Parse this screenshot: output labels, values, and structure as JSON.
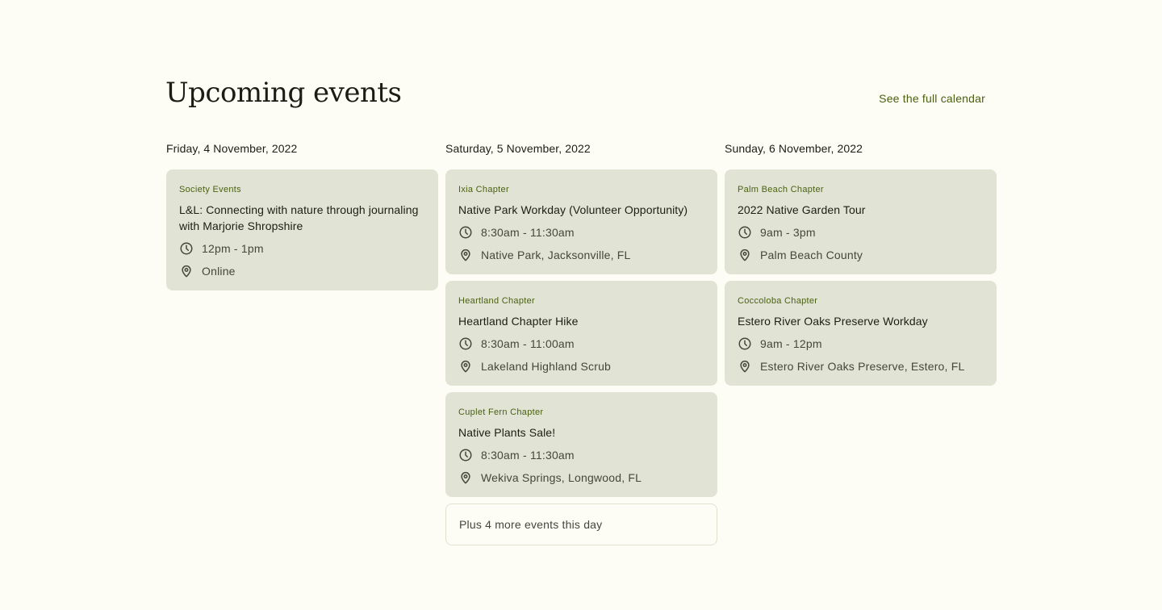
{
  "header": {
    "title": "Upcoming events",
    "calendar_link": "See the full calendar"
  },
  "days": [
    {
      "date": "Friday, 4 November, 2022",
      "events": [
        {
          "chapter": "Society Events",
          "title": "L&L: Connecting with nature through journaling with Marjorie Shropshire",
          "time": "12pm - 1pm",
          "location": "Online"
        }
      ]
    },
    {
      "date": "Saturday, 5 November, 2022",
      "events": [
        {
          "chapter": "Ixia Chapter",
          "title": "Native Park Workday (Volunteer Opportunity)",
          "time": "8:30am - 11:30am",
          "location": "Native Park, Jacksonville, FL"
        },
        {
          "chapter": "Heartland Chapter",
          "title": "Heartland Chapter Hike",
          "time": "8:30am - 11:00am",
          "location": "Lakeland Highland Scrub"
        },
        {
          "chapter": "Cuplet Fern Chapter",
          "title": "Native Plants Sale!",
          "time": "8:30am - 11:30am",
          "location": "Wekiva Springs, Longwood, FL"
        }
      ],
      "more": "Plus 4 more events this day"
    },
    {
      "date": "Sunday, 6 November, 2022",
      "events": [
        {
          "chapter": "Palm Beach Chapter",
          "title": "2022 Native Garden Tour",
          "time": "9am - 3pm",
          "location": "Palm Beach County"
        },
        {
          "chapter": "Coccoloba Chapter",
          "title": "Estero River Oaks Preserve Workday",
          "time": "9am - 12pm",
          "location": "Estero River Oaks Preserve, Estero, FL"
        }
      ]
    }
  ],
  "icons": {
    "time": "clock-icon",
    "location": "map-pin-icon"
  },
  "colors": {
    "background": "#fdfdf5",
    "card": "#e1e4d4",
    "accent": "#4a6010",
    "text": "#1c1e14"
  }
}
